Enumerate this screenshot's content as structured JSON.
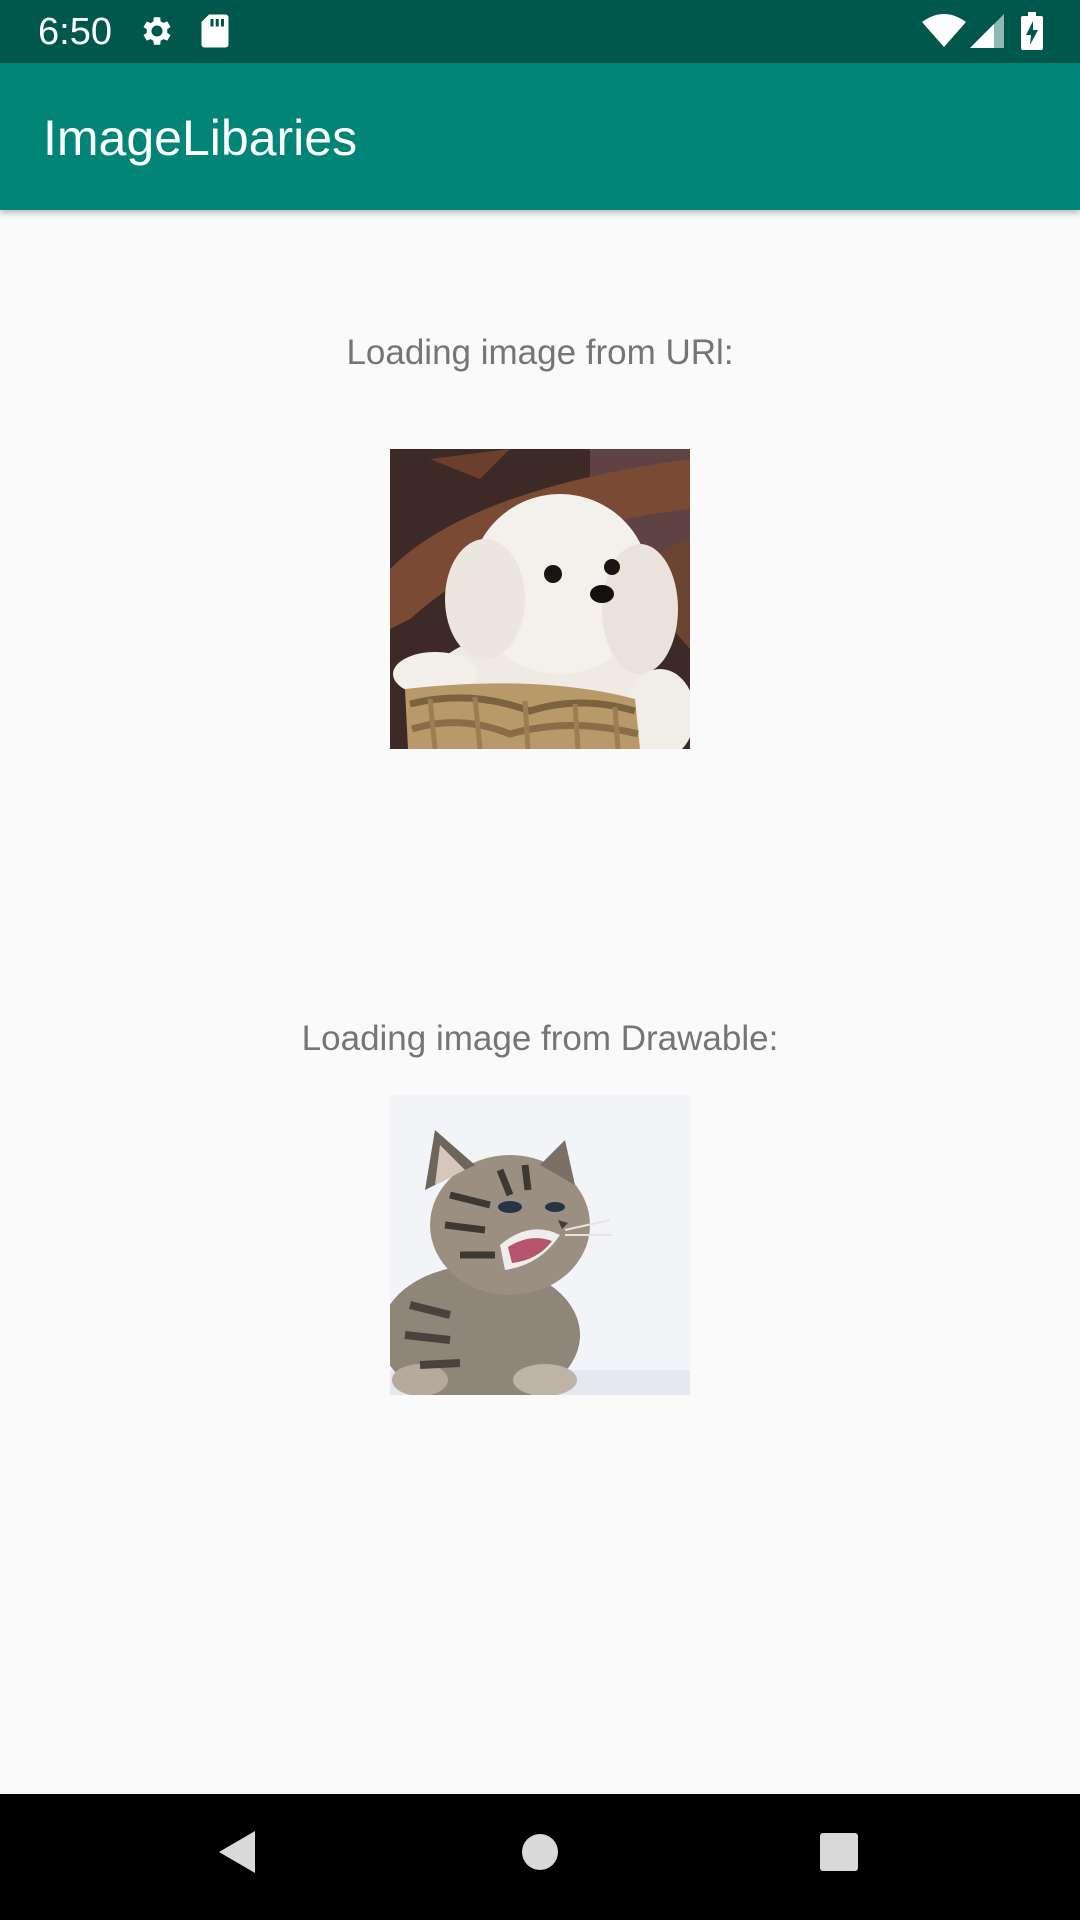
{
  "status_bar": {
    "time": "6:50",
    "icons": [
      "settings-gear-icon",
      "sd-card-icon",
      "wifi-icon",
      "cell-signal-icon",
      "battery-charging-icon"
    ]
  },
  "app_bar": {
    "title": "ImageLibaries",
    "color": "#008577",
    "status_color": "#00574b"
  },
  "content": {
    "url_label": "Loading image from URl:",
    "url_image": "puppy-in-basket",
    "drawable_label": "Loading image from Drawable:",
    "drawable_image": "kitten-meowing"
  },
  "nav_bar": {
    "buttons": [
      "back-icon",
      "home-icon",
      "recents-icon"
    ]
  }
}
